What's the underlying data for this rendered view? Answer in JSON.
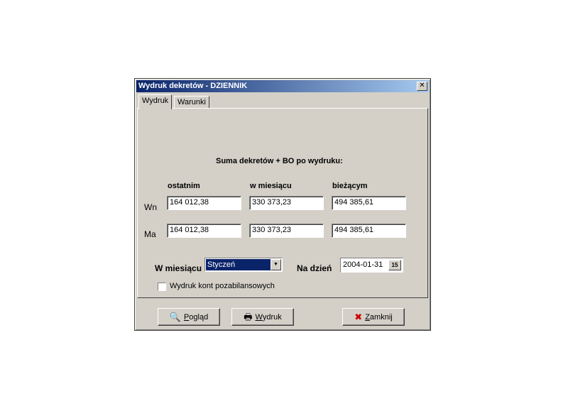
{
  "window": {
    "title": "Wydruk dekretów - DZIENNIK",
    "close_glyph": "✕"
  },
  "tabs": [
    {
      "label": "Wydruk"
    },
    {
      "label": "Warunki"
    }
  ],
  "summary": {
    "heading": "Suma dekretów + BO po wydruku:",
    "columns": [
      "ostatnim",
      "w miesiącu",
      "bieżącym"
    ],
    "rows": [
      {
        "label": "Wn",
        "values": [
          "164 012,38",
          "330 373,23",
          "494 385,61"
        ]
      },
      {
        "label": "Ma",
        "values": [
          "164 012,38",
          "330 373,23",
          "494 385,61"
        ]
      }
    ]
  },
  "month": {
    "label": "W miesiącu",
    "value": "Styczeń"
  },
  "day": {
    "label": "Na dzień",
    "value": "2004-01-31",
    "calendar_glyph": "15"
  },
  "checkbox": {
    "label": "Wydruk kont pozabilansowych",
    "checked": false
  },
  "buttons": {
    "preview": {
      "label_first": "P",
      "label_rest": "ogląd"
    },
    "print": {
      "label_first": "W",
      "label_rest": "ydruk"
    },
    "close": {
      "label_first": "Z",
      "label_rest": "amknij"
    }
  },
  "icons": {
    "preview": "magnifier-icon",
    "print": "printer-icon",
    "close": "red-x-icon"
  },
  "colors": {
    "titlebar_start": "#0a246a",
    "titlebar_end": "#a6caf0",
    "face": "#d4d0c8",
    "close_x": "#cc0000"
  }
}
